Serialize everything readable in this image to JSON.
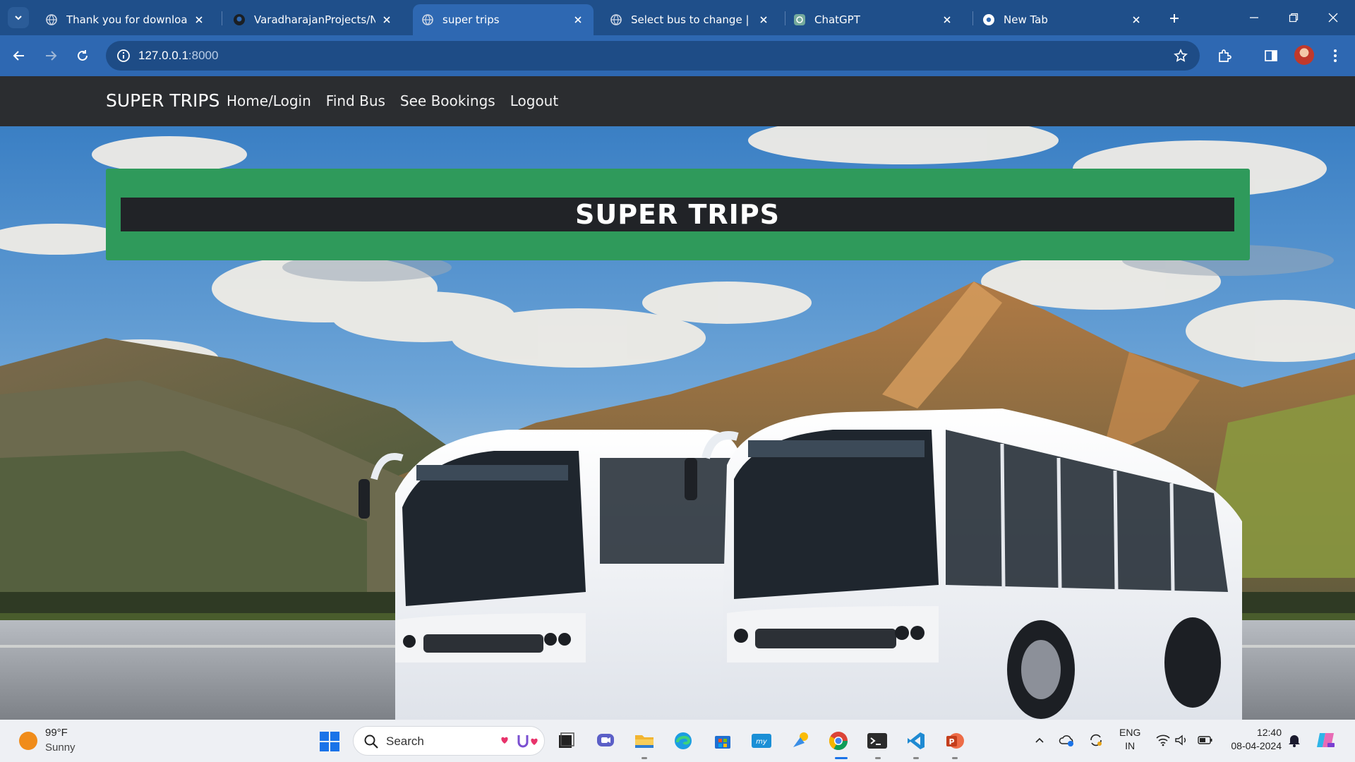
{
  "browser": {
    "tabs": [
      {
        "title": "Thank you for downloading",
        "icon": "globe-icon"
      },
      {
        "title": "VaradharajanProjects/NAN",
        "icon": "github-icon"
      },
      {
        "title": "super trips",
        "icon": "globe-icon",
        "active": true
      },
      {
        "title": "Select bus to change | Djan",
        "icon": "globe-icon"
      },
      {
        "title": "ChatGPT",
        "icon": "chatgpt-icon"
      },
      {
        "title": "New Tab",
        "icon": "chrome-icon"
      }
    ],
    "url_host": "127.0.0.1",
    "url_port": ":8000",
    "colors": {
      "tabstrip": "#1f4f8a",
      "toolbar": "#2e68b2",
      "omnibox": "#1e4c86"
    }
  },
  "site": {
    "brand": "SUPER TRIPS",
    "nav": [
      "Home/Login",
      "Find Bus",
      "See Bookings",
      "Logout"
    ],
    "banner_title": "SUPER TRIPS",
    "colors": {
      "navbar": "#2b2d30",
      "banner": "#2f9a5b",
      "banner_bar": "#212327"
    }
  },
  "taskbar": {
    "weather_temp": "99°F",
    "weather_cond": "Sunny",
    "search_label": "Search",
    "apps": [
      "task-view-icon",
      "chat-icon",
      "file-explorer-icon",
      "edge-icon",
      "store-icon",
      "mylp-icon",
      "weather-app-icon",
      "chrome-icon",
      "terminal-icon",
      "vscode-icon",
      "powerpoint-icon"
    ],
    "lang_line1": "ENG",
    "lang_line2": "IN",
    "time": "12:40",
    "date": "08-04-2024"
  }
}
